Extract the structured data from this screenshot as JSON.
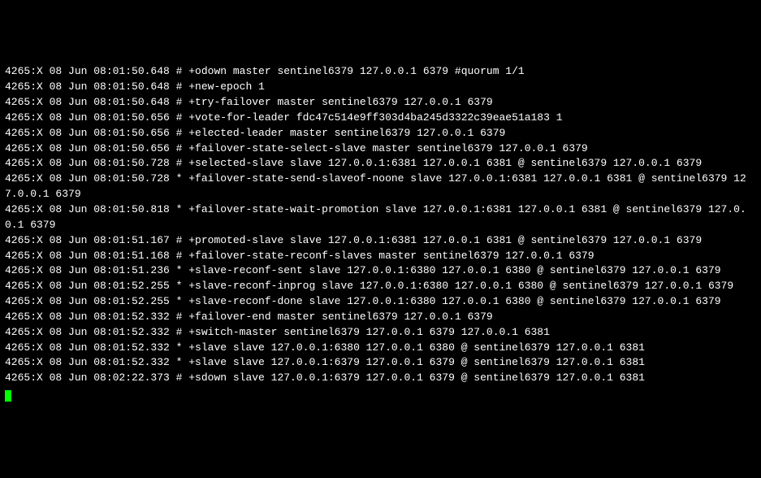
{
  "log": {
    "lines": [
      "4265:X 08 Jun 08:01:50.648 # +odown master sentinel6379 127.0.0.1 6379 #quorum 1/1",
      "4265:X 08 Jun 08:01:50.648 # +new-epoch 1",
      "4265:X 08 Jun 08:01:50.648 # +try-failover master sentinel6379 127.0.0.1 6379",
      "4265:X 08 Jun 08:01:50.656 # +vote-for-leader fdc47c514e9ff303d4ba245d3322c39eae51a183 1",
      "4265:X 08 Jun 08:01:50.656 # +elected-leader master sentinel6379 127.0.0.1 6379",
      "4265:X 08 Jun 08:01:50.656 # +failover-state-select-slave master sentinel6379 127.0.0.1 6379",
      "4265:X 08 Jun 08:01:50.728 # +selected-slave slave 127.0.0.1:6381 127.0.0.1 6381 @ sentinel6379 127.0.0.1 6379",
      "4265:X 08 Jun 08:01:50.728 * +failover-state-send-slaveof-noone slave 127.0.0.1:6381 127.0.0.1 6381 @ sentinel6379 127.0.0.1 6379",
      "4265:X 08 Jun 08:01:50.818 * +failover-state-wait-promotion slave 127.0.0.1:6381 127.0.0.1 6381 @ sentinel6379 127.0.0.1 6379",
      "4265:X 08 Jun 08:01:51.167 # +promoted-slave slave 127.0.0.1:6381 127.0.0.1 6381 @ sentinel6379 127.0.0.1 6379",
      "4265:X 08 Jun 08:01:51.168 # +failover-state-reconf-slaves master sentinel6379 127.0.0.1 6379",
      "4265:X 08 Jun 08:01:51.236 * +slave-reconf-sent slave 127.0.0.1:6380 127.0.0.1 6380 @ sentinel6379 127.0.0.1 6379",
      "4265:X 08 Jun 08:01:52.255 * +slave-reconf-inprog slave 127.0.0.1:6380 127.0.0.1 6380 @ sentinel6379 127.0.0.1 6379",
      "4265:X 08 Jun 08:01:52.255 * +slave-reconf-done slave 127.0.0.1:6380 127.0.0.1 6380 @ sentinel6379 127.0.0.1 6379",
      "4265:X 08 Jun 08:01:52.332 # +failover-end master sentinel6379 127.0.0.1 6379",
      "4265:X 08 Jun 08:01:52.332 # +switch-master sentinel6379 127.0.0.1 6379 127.0.0.1 6381",
      "4265:X 08 Jun 08:01:52.332 * +slave slave 127.0.0.1:6380 127.0.0.1 6380 @ sentinel6379 127.0.0.1 6381",
      "4265:X 08 Jun 08:01:52.332 * +slave slave 127.0.0.1:6379 127.0.0.1 6379 @ sentinel6379 127.0.0.1 6381",
      "4265:X 08 Jun 08:02:22.373 # +sdown slave 127.0.0.1:6379 127.0.0.1 6379 @ sentinel6379 127.0.0.1 6381"
    ]
  }
}
